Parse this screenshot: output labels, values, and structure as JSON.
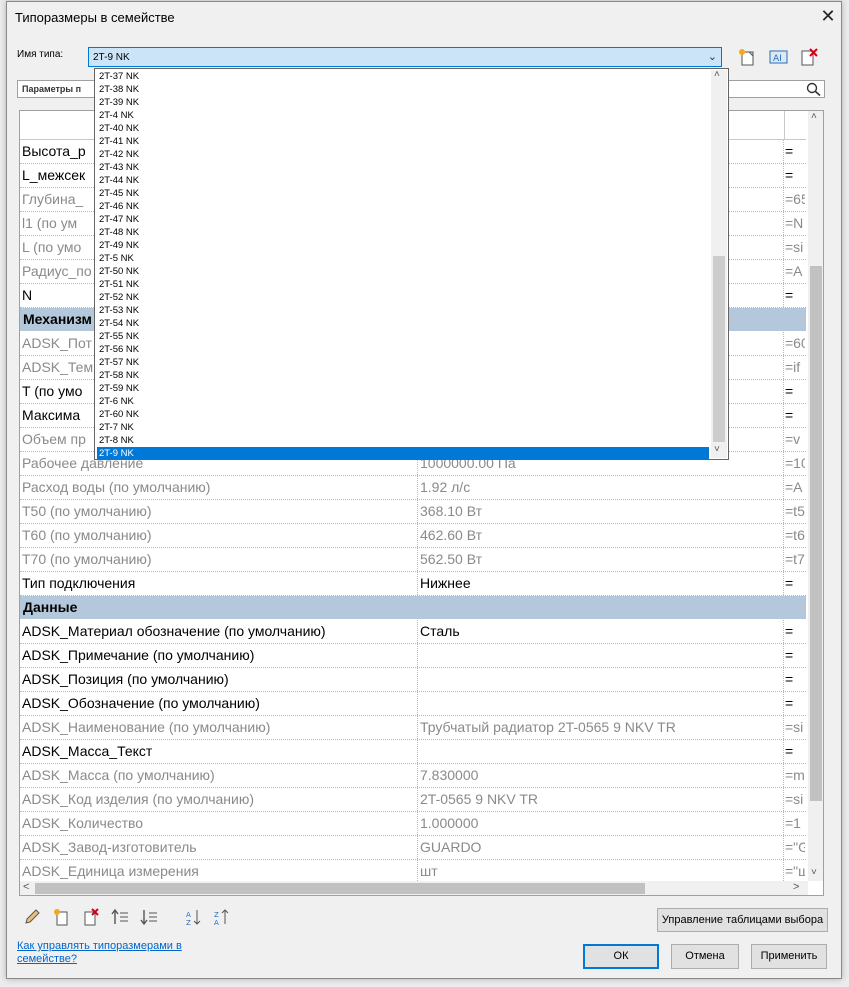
{
  "window": {
    "title": "Типоразмеры в семействе",
    "close_glyph": "✕"
  },
  "type_name": {
    "label": "Имя типа:",
    "value": "2T-9 NK"
  },
  "params_label": "Параметры п",
  "dropdown": {
    "items": [
      "2T-37 NK",
      "2T-38 NK",
      "2T-39 NK",
      "2T-4 NK",
      "2T-40 NK",
      "2T-41 NK",
      "2T-42 NK",
      "2T-43 NK",
      "2T-44 NK",
      "2T-45 NK",
      "2T-46 NK",
      "2T-47 NK",
      "2T-48 NK",
      "2T-49 NK",
      "2T-5 NK",
      "2T-50 NK",
      "2T-51 NK",
      "2T-52 NK",
      "2T-53 NK",
      "2T-54 NK",
      "2T-55 NK",
      "2T-56 NK",
      "2T-57 NK",
      "2T-58 NK",
      "2T-59 NK",
      "2T-6 NK",
      "2T-60 NK",
      "2T-7 NK",
      "2T-8 NK",
      "2T-9 NK"
    ],
    "selected": "2T-9 NK"
  },
  "table": {
    "rows": [
      {
        "kind": "param",
        "name": "Высота_р",
        "value": "",
        "formula": "=",
        "dim": false
      },
      {
        "kind": "param",
        "name": "L_межсек",
        "value": "",
        "formula": "=",
        "dim": false
      },
      {
        "kind": "param",
        "name": "Глубина_",
        "value": "",
        "formula": "=65",
        "dim": true
      },
      {
        "kind": "param",
        "name": "l1 (по ум",
        "value": "",
        "formula": "=N",
        "dim": true
      },
      {
        "kind": "param",
        "name": "L (по умо",
        "value": "",
        "formula": "=si",
        "dim": true
      },
      {
        "kind": "param",
        "name": "Радиус_по",
        "value": "",
        "formula": "=A",
        "dim": true
      },
      {
        "kind": "param",
        "name": "N",
        "value": "",
        "formula": "=",
        "dim": false
      },
      {
        "kind": "group",
        "name": "Механизм"
      },
      {
        "kind": "param",
        "name": "ADSK_Пот",
        "value": "",
        "formula": "=60",
        "dim": true
      },
      {
        "kind": "param",
        "name": "ADSK_Тем",
        "value": "",
        "formula": "=if",
        "dim": true
      },
      {
        "kind": "param",
        "name": "T (по умо",
        "value": "",
        "formula": "=",
        "dim": false
      },
      {
        "kind": "param",
        "name": "Максима",
        "value": "",
        "formula": "=",
        "dim": false
      },
      {
        "kind": "param",
        "name": "Объем пр",
        "value": "",
        "formula": "=v",
        "dim": true
      },
      {
        "kind": "param",
        "name": "Рабочее давление",
        "value": "1000000.00 Па",
        "formula": "=10",
        "dim": true
      },
      {
        "kind": "param",
        "name": "Расход воды (по умолчанию)",
        "value": "1.92 л/с",
        "formula": "=A",
        "dim": true
      },
      {
        "kind": "param",
        "name": "T50 (по умолчанию)",
        "value": "368.10 Вт",
        "formula": "=t5",
        "dim": true
      },
      {
        "kind": "param",
        "name": "T60 (по умолчанию)",
        "value": "462.60 Вт",
        "formula": "=t6",
        "dim": true
      },
      {
        "kind": "param",
        "name": "T70 (по умолчанию)",
        "value": "562.50 Вт",
        "formula": "=t7",
        "dim": true
      },
      {
        "kind": "param",
        "name": "Тип подключения",
        "value": "Нижнее",
        "formula": "=",
        "dim": false
      },
      {
        "kind": "group",
        "name": "Данные"
      },
      {
        "kind": "param",
        "name": "ADSK_Материал обозначение (по умолчанию)",
        "value": "Сталь",
        "formula": "=",
        "dim": false
      },
      {
        "kind": "param",
        "name": "ADSK_Примечание (по умолчанию)",
        "value": "",
        "formula": "=",
        "dim": false
      },
      {
        "kind": "param",
        "name": "ADSK_Позиция (по умолчанию)",
        "value": "",
        "formula": "=",
        "dim": false
      },
      {
        "kind": "param",
        "name": "ADSK_Обозначение (по умолчанию)",
        "value": "",
        "formula": "=",
        "dim": false
      },
      {
        "kind": "param",
        "name": "ADSK_Наименование (по умолчанию)",
        "value": "Трубчатый радиатор 2T-0565 9 NKV TR",
        "formula": "=si",
        "dim": true
      },
      {
        "kind": "param",
        "name": "ADSK_Масса_Текст",
        "value": "",
        "formula": "=",
        "dim": false
      },
      {
        "kind": "param",
        "name": "ADSK_Масса (по умолчанию)",
        "value": "7.830000",
        "formula": "=m",
        "dim": true
      },
      {
        "kind": "param",
        "name": "ADSK_Код изделия (по умолчанию)",
        "value": "2T-0565 9 NKV TR",
        "formula": "=si",
        "dim": true
      },
      {
        "kind": "param",
        "name": "ADSK_Количество",
        "value": "1.000000",
        "formula": "=1",
        "dim": true
      },
      {
        "kind": "param",
        "name": "ADSK_Завод-изготовитель",
        "value": "GUARDO",
        "formula": "=\"G",
        "dim": true
      },
      {
        "kind": "param",
        "name": "ADSK_Единица измерения",
        "value": "шт",
        "formula": "=\"ш",
        "dim": true
      }
    ]
  },
  "buttons": {
    "manage": "Управление таблицами выбора",
    "ok": "ОК",
    "cancel": "Отмена",
    "apply": "Применить"
  },
  "help_link": "Как управлять типоразмерами в семействе?",
  "colors": {
    "accent": "#0078d7",
    "group_bg": "#b4c8dc",
    "dim_text": "#8a8a8a"
  }
}
